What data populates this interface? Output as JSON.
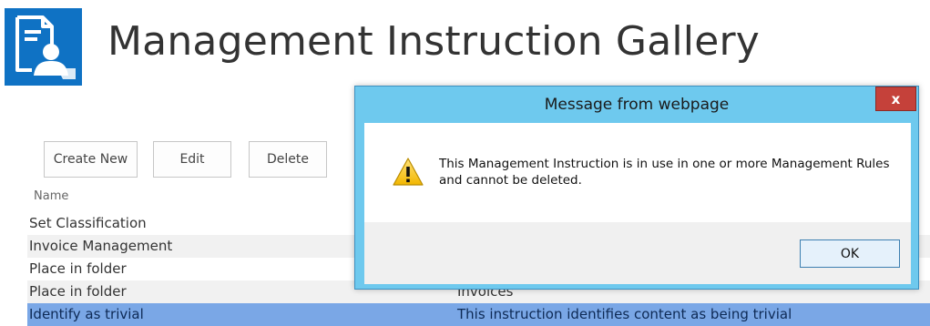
{
  "header": {
    "title": "Management Instruction Gallery",
    "logo_icon": "document-user-icon",
    "logo_color": "#0f72c4"
  },
  "toolbar": {
    "create_label": "Create New",
    "edit_label": "Edit",
    "delete_label": "Delete"
  },
  "list": {
    "column_name": "Name",
    "rows": [
      {
        "name": "Set Classification",
        "description": ""
      },
      {
        "name": "Invoice Management",
        "description": ""
      },
      {
        "name": "Place in folder",
        "description": ""
      },
      {
        "name": "Place in folder",
        "description": "Invoices"
      },
      {
        "name": "Identify as trivial",
        "description": "This instruction identifies content as being trivial"
      }
    ],
    "selected_color": "#7aa7e6"
  },
  "dialog": {
    "title": "Message from webpage",
    "close_label": "x",
    "message": "This Management Instruction is in use in one or more Management Rules and cannot be deleted.",
    "ok_label": "OK",
    "icon": "warning-icon",
    "frame_color": "#6ec9ee",
    "close_color": "#c5413a"
  }
}
